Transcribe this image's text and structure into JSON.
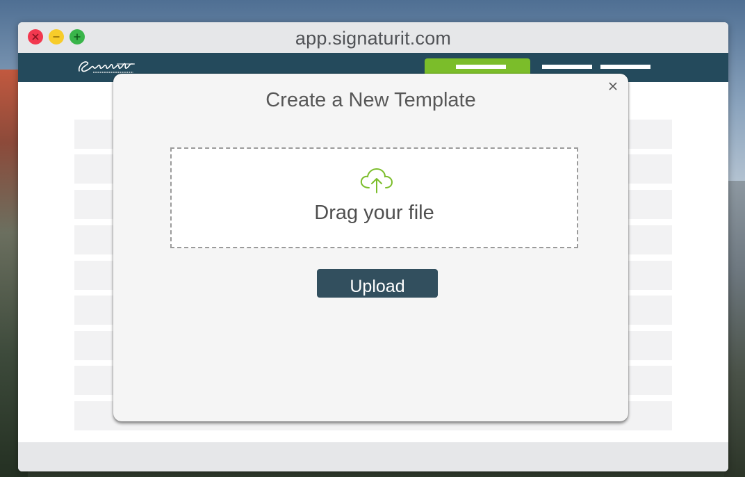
{
  "browser": {
    "url": "app.signaturit.com"
  },
  "navbar": {
    "logo_text": "Signaturit",
    "logo_tagline": "Sign anywhere, anytime"
  },
  "modal": {
    "title": "Create a New Template",
    "dropzone_text": "Drag your file",
    "upload_label": "Upload"
  },
  "icons": {
    "close": "close-icon",
    "upload": "cloud-upload-icon"
  },
  "colors": {
    "navbar": "#244a5c",
    "accent": "#7bbd2a",
    "upload_button": "#324f5e",
    "cloud_icon": "#7bbd2a"
  }
}
